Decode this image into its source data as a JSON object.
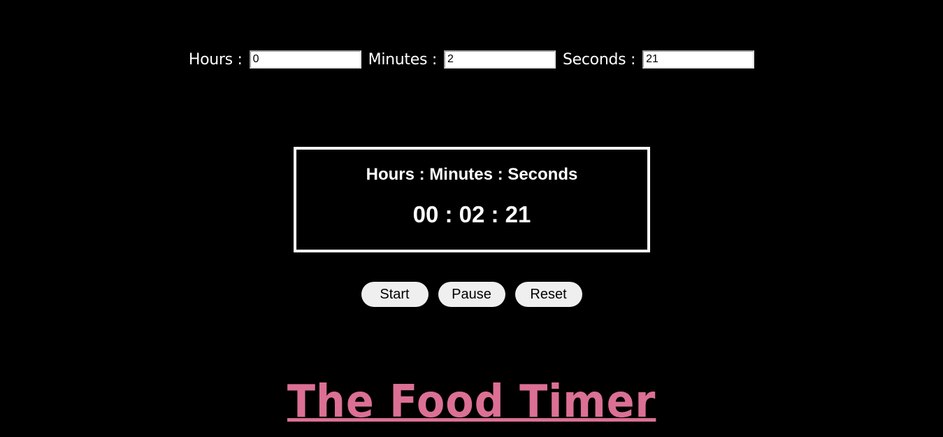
{
  "inputs": {
    "hours_label": "Hours :",
    "hours_value": "0",
    "minutes_label": "Minutes :",
    "minutes_value": "2",
    "seconds_label": "Seconds :",
    "seconds_value": "21"
  },
  "clock": {
    "heading": "Hours : Minutes : Seconds",
    "time": "00 : 02 : 21"
  },
  "controls": {
    "start_label": "Start",
    "pause_label": "Pause",
    "reset_label": "Reset"
  },
  "brand": {
    "title": "The Food Timer",
    "color": "#db7093"
  },
  "colors": {
    "background": "#000000",
    "text": "#ffffff",
    "button_bg": "#efefef"
  }
}
